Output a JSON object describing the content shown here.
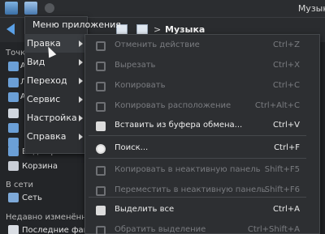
{
  "window": {
    "title": "Музык"
  },
  "toolbar": {
    "crumb_separator": ">",
    "crumb_label": "Музыка"
  },
  "places": {
    "heading_places": "Точки",
    "stub_items": [
      "А",
      "Л",
      "А"
    ],
    "video": "Видеофайлы",
    "trash": "Корзина",
    "heading_network": "В сети",
    "network": "Сеть",
    "heading_recent": "Недавно изменённ",
    "recent": "Последние файл"
  },
  "app_menu": {
    "title": "Меню приложения",
    "items": [
      {
        "label": "Правка",
        "has_submenu": true
      },
      {
        "label": "Вид",
        "has_submenu": true
      },
      {
        "label": "Переход",
        "has_submenu": true
      },
      {
        "label": "Сервис",
        "has_submenu": true
      },
      {
        "label": "Настройка",
        "has_submenu": true
      },
      {
        "label": "Справка",
        "has_submenu": true
      }
    ]
  },
  "edit_menu": {
    "items": [
      {
        "label": "Отменить действие",
        "shortcut": "Ctrl+Z",
        "enabled": false,
        "icon": "undo-icon"
      },
      {
        "label": "Вырезать",
        "shortcut": "Ctrl+X",
        "enabled": false,
        "icon": "scissors-icon"
      },
      {
        "label": "Копировать",
        "shortcut": "Ctrl+C",
        "enabled": false,
        "icon": "copy-icon"
      },
      {
        "label": "Копировать расположение",
        "shortcut": "Ctrl+Alt+C",
        "enabled": false,
        "icon": "copy-location-icon"
      },
      {
        "label": "Вставить из буфера обмена...",
        "shortcut": "Ctrl+V",
        "enabled": true,
        "icon": "paste-icon"
      },
      {
        "label": "Поиск...",
        "shortcut": "Ctrl+F",
        "enabled": true,
        "icon": "binoculars-icon"
      },
      {
        "label": "Копировать в неактивную панель",
        "shortcut": "Shift+F5",
        "enabled": false,
        "icon": "copy-to-panel-icon"
      },
      {
        "label": "Переместить в неактивную панель",
        "shortcut": "Shift+F6",
        "enabled": false,
        "icon": "move-to-panel-icon"
      },
      {
        "label": "Выделить все",
        "shortcut": "Ctrl+A",
        "enabled": true,
        "icon": "select-all-icon"
      },
      {
        "label": "Обратить выделение",
        "shortcut": "Ctrl+Shift+A",
        "enabled": false,
        "icon": "invert-selection-icon"
      }
    ]
  },
  "colors": {
    "background": "#1f2124",
    "menu": "#2d2f32",
    "text": "#eaeaea",
    "disabled": "#7a7c80",
    "accent": "#5aa0e6"
  }
}
